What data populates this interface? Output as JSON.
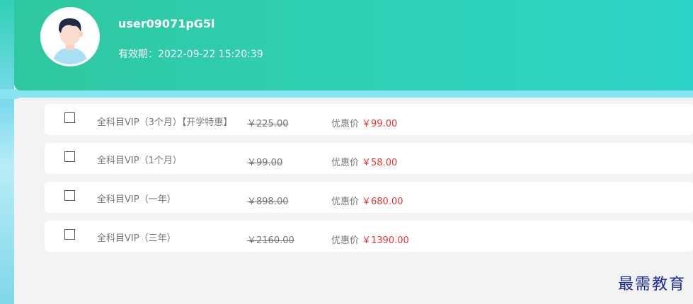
{
  "user": {
    "username": "user09071pG5l",
    "validity_label": "有效期：",
    "validity_value": "2022-09-22 15:20:39"
  },
  "products": [
    {
      "name": "全科目VIP（3个月）【开学特惠】",
      "original_price": "￥225.00",
      "discount_label": "优惠价",
      "discount_price": "￥99.00"
    },
    {
      "name": "全科目VIP（1个月）",
      "original_price": "￥99.00",
      "discount_label": "优惠价",
      "discount_price": "￥58.00"
    },
    {
      "name": "全科目VIP（一年）",
      "original_price": "￥898.00",
      "discount_label": "优惠价",
      "discount_price": "￥680.00"
    },
    {
      "name": "全科目VIP（三年）",
      "original_price": "￥2160.00",
      "discount_label": "优惠价",
      "discount_price": "￥1390.00"
    }
  ],
  "watermark": "最需教育",
  "colors": {
    "header_accent": "#2dc8a0",
    "discount_price": "#ee3333",
    "watermark": "#1c2b9c"
  }
}
